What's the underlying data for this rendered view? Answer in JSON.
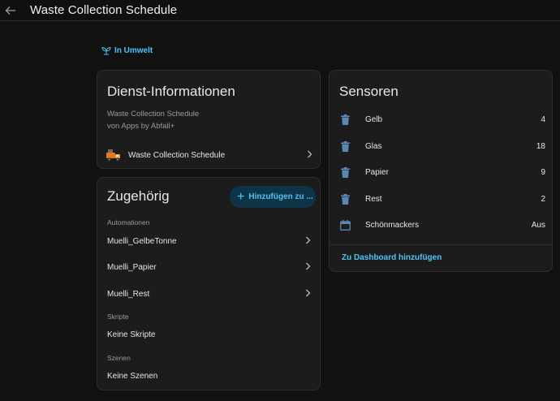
{
  "header": {
    "title": "Waste Collection Schedule"
  },
  "area": {
    "label": "In Umwelt"
  },
  "info_card": {
    "title": "Dienst-Informationen",
    "integration": "Waste Collection Schedule",
    "provider": "von Apps by Abfall+",
    "device_label": "Waste Collection Schedule"
  },
  "related_card": {
    "title": "Zugehörig",
    "add_button": "Hinzufügen zu ...",
    "automations_header": "Automationen",
    "automations": [
      {
        "label": "Muelli_GelbeTonne"
      },
      {
        "label": "Muelli_Papier"
      },
      {
        "label": "Muelli_Rest"
      }
    ],
    "scripts_header": "Skripte",
    "scripts_empty": "Keine Skripte",
    "scenes_header": "Szenen",
    "scenes_empty": "Keine Szenen"
  },
  "sensors_card": {
    "title": "Sensoren",
    "items": [
      {
        "name": "Gelb",
        "value": "4",
        "icon": "trash-can-icon"
      },
      {
        "name": "Glas",
        "value": "18",
        "icon": "trash-can-icon"
      },
      {
        "name": "Papier",
        "value": "9",
        "icon": "trash-can-icon"
      },
      {
        "name": "Rest",
        "value": "2",
        "icon": "trash-can-icon"
      },
      {
        "name": "Schönmackers",
        "value": "Aus",
        "icon": "calendar-icon"
      }
    ],
    "dashboard_link": "Zu Dashboard hinzufügen"
  },
  "colors": {
    "accent": "#4fc3f7",
    "icon_blue": "#5a86b8",
    "background": "#111111",
    "card": "#1c1c1c"
  }
}
